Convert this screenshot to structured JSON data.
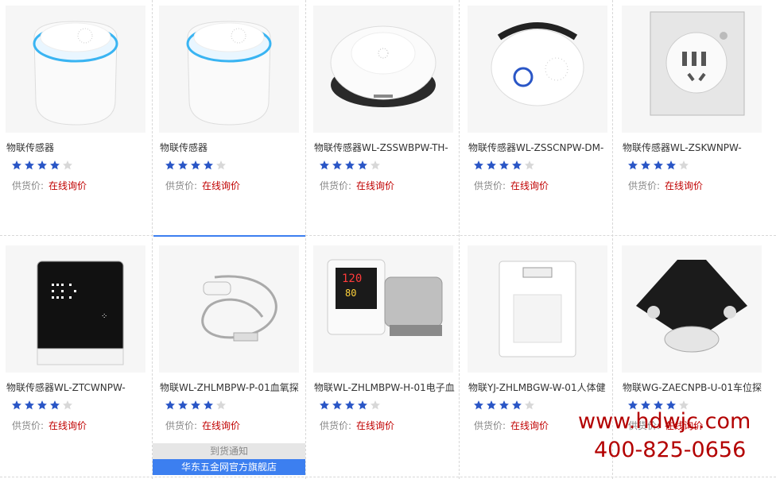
{
  "products": [
    {
      "name": "物联传感器",
      "rating": 4,
      "price_label": "供货价:",
      "price_value": "在线询价",
      "image": "round-air-sensor"
    },
    {
      "name": "物联传感器",
      "rating": 4,
      "price_label": "供货价:",
      "price_value": "在线询价",
      "image": "round-air-sensor"
    },
    {
      "name": "物联传感器WL-ZSSWBPW-TH-",
      "rating": 4,
      "price_label": "供货价:",
      "price_value": "在线询价",
      "image": "dome-sensor"
    },
    {
      "name": "物联传感器WL-ZSSCNPW-DM-",
      "rating": 4,
      "price_label": "供货价:",
      "price_value": "在线询价",
      "image": "smoke-detector"
    },
    {
      "name": "物联传感器WL-ZSKWNPW-",
      "rating": 4,
      "price_label": "供货价:",
      "price_value": "在线询价",
      "image": "wall-socket"
    },
    {
      "name": "物联传感器WL-ZTCWNPW-",
      "rating": 4,
      "price_label": "供货价:",
      "price_value": "在线询价",
      "image": "touch-panel"
    },
    {
      "name": "物联WL-ZHLMBPW-P-01血氧探",
      "rating": 4,
      "price_label": "供货价:",
      "price_value": "在线询价",
      "image": "oximeter-cable"
    },
    {
      "name": "物联WL-ZHLMBPW-H-01电子血",
      "rating": 4,
      "price_label": "供货价:",
      "price_value": "在线询价",
      "image": "blood-pressure-monitor"
    },
    {
      "name": "物联YJ-ZHLMBGW-W-01人体健",
      "rating": 4,
      "price_label": "供货价:",
      "price_value": "在线询价",
      "image": "body-scale"
    },
    {
      "name": "物联WG-ZAECNPB-U-01车位探",
      "rating": 4,
      "price_label": "供货价:",
      "price_value": "在线询价",
      "image": "parking-sensor"
    }
  ],
  "hover_actions": {
    "notice": "到货通知",
    "store": "华东五金网官方旗舰店"
  },
  "watermark": {
    "url": "www.hdwjc.com",
    "phone": "400-825-0656"
  },
  "colors": {
    "star": "#2a56c6",
    "price_link": "#c00000",
    "store_bg": "#3c7ff0",
    "watermark": "#b30000"
  }
}
